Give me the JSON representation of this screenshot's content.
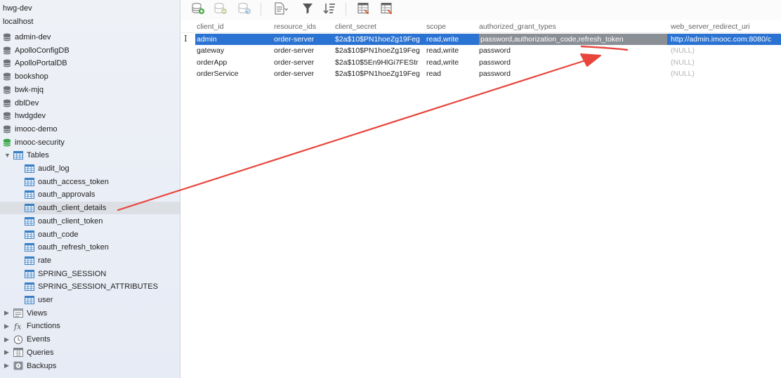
{
  "sidebar": {
    "connections_top": [
      {
        "label": "hwg-dev"
      },
      {
        "label": "localhost"
      }
    ],
    "databases": [
      {
        "label": "admin-dev",
        "active": false
      },
      {
        "label": "ApolloConfigDB",
        "active": false
      },
      {
        "label": "ApolloPortalDB",
        "active": false
      },
      {
        "label": "bookshop",
        "active": false
      },
      {
        "label": "bwk-mjq",
        "active": false
      },
      {
        "label": "dblDev",
        "active": false
      },
      {
        "label": "hwdgdev",
        "active": false
      },
      {
        "label": "imooc-demo",
        "active": false
      },
      {
        "label": "imooc-security",
        "active": true
      }
    ],
    "tables_label": "Tables",
    "tables": [
      {
        "label": "audit_log"
      },
      {
        "label": "oauth_access_token"
      },
      {
        "label": "oauth_approvals"
      },
      {
        "label": "oauth_client_details",
        "selected": true
      },
      {
        "label": "oauth_client_token"
      },
      {
        "label": "oauth_code"
      },
      {
        "label": "oauth_refresh_token"
      },
      {
        "label": "rate"
      },
      {
        "label": "SPRING_SESSION"
      },
      {
        "label": "SPRING_SESSION_ATTRIBUTES"
      },
      {
        "label": "user"
      }
    ],
    "groups": [
      {
        "label": "Views",
        "icon": "views-icon"
      },
      {
        "label": "Functions",
        "icon": "function-icon"
      },
      {
        "label": "Events",
        "icon": "clock-icon"
      },
      {
        "label": "Queries",
        "icon": "query-icon"
      },
      {
        "label": "Backups",
        "icon": "backup-icon"
      }
    ]
  },
  "toolbar": {
    "buttons": [
      "add-record-icon",
      "delete-record-icon",
      "refresh-record-icon",
      "text-view-icon",
      "filter-icon",
      "sort-icon",
      "import-icon",
      "export-icon"
    ]
  },
  "grid": {
    "columns": [
      "client_id",
      "resource_ids",
      "client_secret",
      "scope",
      "authorized_grant_types",
      "web_server_redirect_uri"
    ],
    "rows": [
      {
        "client_id": "admin",
        "resource_ids": "order-server",
        "client_secret": "$2a$10$PN1hoeZg19Feg",
        "scope": "read,write",
        "authorized_grant_types": "password,authorization_code,refresh_token",
        "web_server_redirect_uri": "http://admin.imooc.com:8080/c",
        "selected": true
      },
      {
        "client_id": "gateway",
        "resource_ids": "order-server",
        "client_secret": "$2a$10$PN1hoeZg19Feg",
        "scope": "read,write",
        "authorized_grant_types": "password",
        "web_server_redirect_uri": "(NULL)"
      },
      {
        "client_id": "orderApp",
        "resource_ids": "order-server",
        "client_secret": "$2a$10$5En9HlGi7FEStr",
        "scope": "read,write",
        "authorized_grant_types": "password",
        "web_server_redirect_uri": "(NULL)"
      },
      {
        "client_id": "orderService",
        "resource_ids": "order-server",
        "client_secret": "$2a$10$PN1hoeZg19Feg",
        "scope": "read",
        "authorized_grant_types": "password",
        "web_server_redirect_uri": "(NULL)"
      }
    ],
    "row_marker": "I"
  },
  "colors": {
    "selection": "#2b73d2",
    "cell_highlight": "#8a8f96",
    "annotation": "#e8453c",
    "db_icon": "#6e7379",
    "db_icon_active": "#3aa64a",
    "table_icon": "#3b7fc4"
  }
}
